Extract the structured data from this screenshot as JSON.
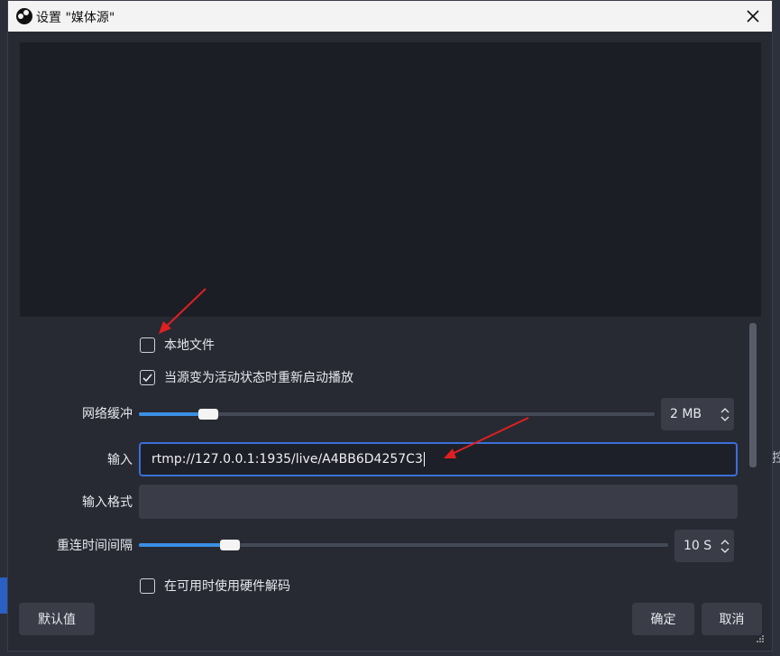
{
  "window": {
    "title": "设置 \"媒体源\""
  },
  "icons": {
    "app": "obs-icon",
    "close": "close-icon",
    "check": "check-icon",
    "spin_up": "chevron-up-icon",
    "spin_down": "chevron-down-icon"
  },
  "form": {
    "local_file": {
      "label": "本地文件",
      "checked": false
    },
    "restart_on_active": {
      "label": "当源变为活动状态时重新启动播放",
      "checked": true
    },
    "network_buffer": {
      "label": "网络缓冲",
      "value_text": "2 MB",
      "level": 0.12
    },
    "input": {
      "label": "输入",
      "value": "rtmp://127.0.0.1:1935/live/A4BB6D4257C3"
    },
    "input_format": {
      "label": "输入格式",
      "value": ""
    },
    "reconnect_interval": {
      "label": "重连时间间隔",
      "value_text": "10 S",
      "level": 0.16
    },
    "hw_decode": {
      "label": "在可用时使用硬件解码",
      "checked": false
    }
  },
  "buttons": {
    "defaults": "默认值",
    "ok": "确定",
    "cancel": "取消"
  },
  "background": {
    "edge_char": "控"
  },
  "colors": {
    "accent": "#3b8fe3",
    "focus_border": "#3b6fd6",
    "annotation_arrow": "#e02020"
  }
}
